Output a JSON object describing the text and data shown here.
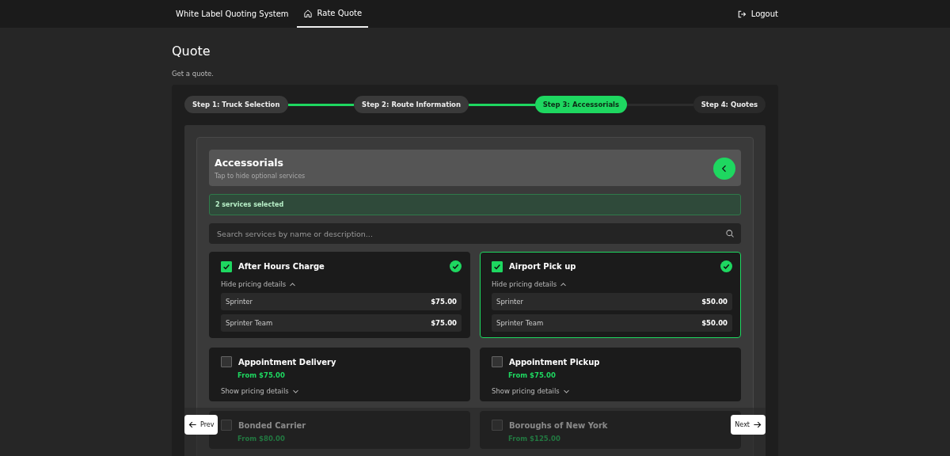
{
  "nav": {
    "brand": "White Label Quoting System",
    "tabs": [
      {
        "label": "Rate Quote",
        "selected": true
      }
    ],
    "logout": "Logout"
  },
  "page": {
    "title": "Quote",
    "subtitle": "Get a quote."
  },
  "steps": [
    {
      "label": "Step 1: Truck Selection",
      "completed": true,
      "selected": false
    },
    {
      "label": "Step 2: Route Information",
      "completed": true,
      "selected": false
    },
    {
      "label": "Step 3: Accessorials",
      "completed": false,
      "selected": true
    },
    {
      "label": "Step 4: Quotes",
      "completed": false,
      "selected": false
    }
  ],
  "section": {
    "title": "Accessorials",
    "hint": "Tap to hide optional services",
    "selected_count": "2 services selected",
    "search": {
      "placeholder": "Search services by name or description..."
    }
  },
  "services": [
    {
      "name": "After Hours Charge",
      "selected": true,
      "expanded": true,
      "toggle": "Hide pricing details",
      "prices": [
        {
          "label": "Sprinter",
          "amount": "$75.00"
        },
        {
          "label": "Sprinter Team",
          "amount": "$75.00"
        }
      ]
    },
    {
      "name": "Airport Pick up",
      "selected": true,
      "expanded": true,
      "toggle": "Hide pricing details",
      "prices": [
        {
          "label": "Sprinter",
          "amount": "$50.00"
        },
        {
          "label": "Sprinter Team",
          "amount": "$50.00"
        }
      ]
    },
    {
      "name": "Appointment Delivery",
      "selected": false,
      "expanded": false,
      "from": "From $75.00",
      "toggle": "Show pricing details"
    },
    {
      "name": "Appointment Pickup",
      "selected": false,
      "expanded": false,
      "from": "From $75.00",
      "toggle": "Show pricing details"
    },
    {
      "name": "Bonded Carrier",
      "selected": false,
      "from": "From $80.00"
    },
    {
      "name": "Boroughs of New York",
      "selected": false,
      "from": "From $125.00"
    }
  ],
  "footer": {
    "prev": "Prev",
    "next": "Next"
  }
}
